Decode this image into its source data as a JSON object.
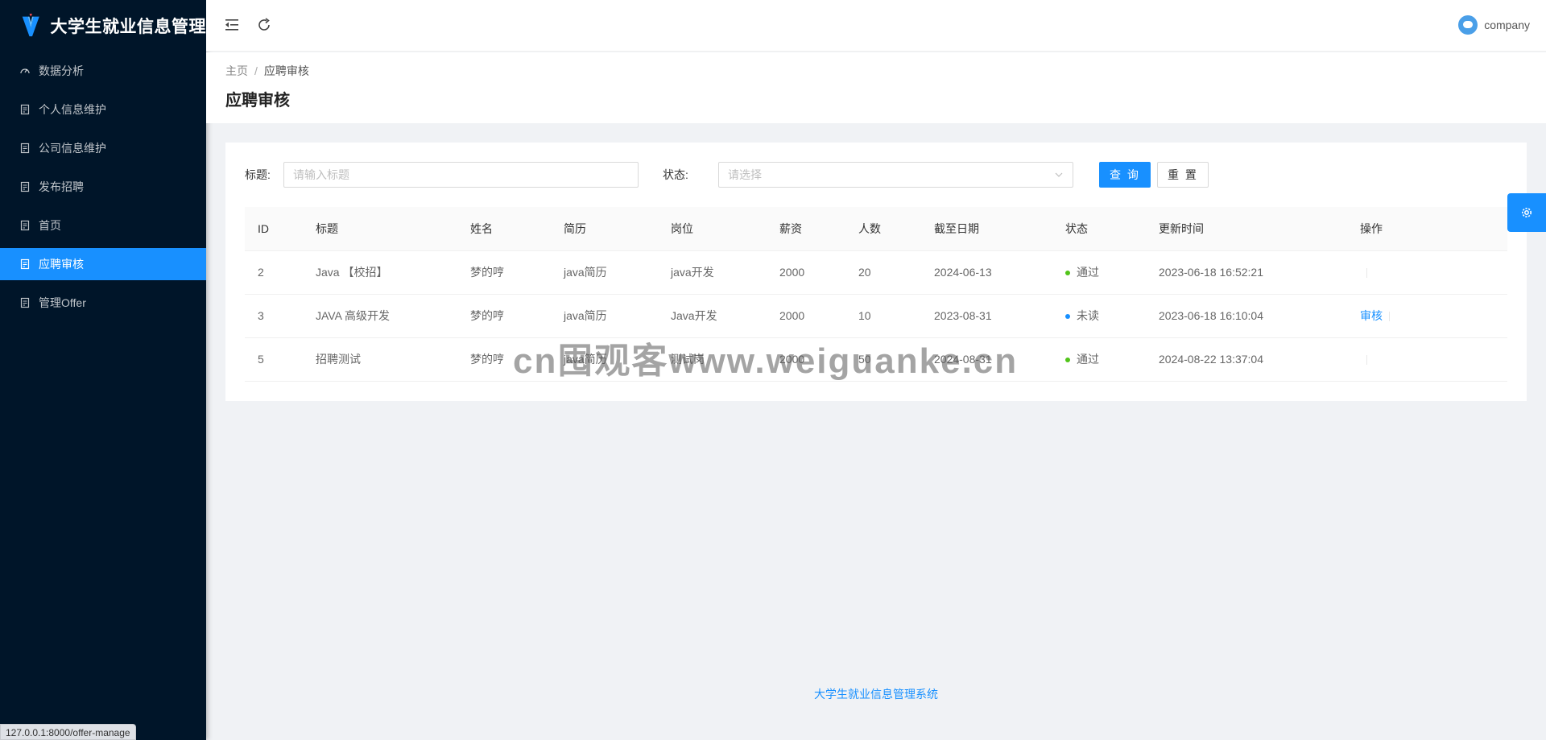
{
  "app": {
    "title": "大学生就业信息管理"
  },
  "sidebar": {
    "items": [
      {
        "label": "数据分析",
        "icon": "dashboard-icon",
        "active": false
      },
      {
        "label": "个人信息维护",
        "icon": "file-icon",
        "active": false
      },
      {
        "label": "公司信息维护",
        "icon": "file-icon",
        "active": false
      },
      {
        "label": "发布招聘",
        "icon": "file-icon",
        "active": false
      },
      {
        "label": "首页",
        "icon": "file-icon",
        "active": false
      },
      {
        "label": "应聘审核",
        "icon": "file-icon",
        "active": true
      },
      {
        "label": "管理Offer",
        "icon": "file-icon",
        "active": false
      }
    ]
  },
  "header": {
    "username": "company",
    "collapse_icon": "menu-fold-icon",
    "reload_icon": "reload-icon"
  },
  "page": {
    "breadcrumb": [
      "主页",
      "应聘审核"
    ],
    "title": "应聘审核"
  },
  "search": {
    "title_label": "标题:",
    "title_placeholder": "请输入标题",
    "status_label": "状态:",
    "status_placeholder": "请选择",
    "query_button": "查 询",
    "reset_button": "重 置"
  },
  "table": {
    "columns": [
      "ID",
      "标题",
      "姓名",
      "简历",
      "岗位",
      "薪资",
      "人数",
      "截至日期",
      "状态",
      "更新时间",
      "操作"
    ],
    "rows": [
      {
        "id": "2",
        "title": "Java 【校招】",
        "name": "梦的哼",
        "resume": "java简历",
        "position": "java开发",
        "salary": "2000",
        "count": "20",
        "deadline": "2024-06-13",
        "status": "通过",
        "status_color": "#52c41a",
        "updated": "2023-06-18 16:52:21",
        "action": ""
      },
      {
        "id": "3",
        "title": "JAVA 高级开发",
        "name": "梦的哼",
        "resume": "java简历",
        "position": "Java开发",
        "salary": "2000",
        "count": "10",
        "deadline": "2023-08-31",
        "status": "未读",
        "status_color": "#1890ff",
        "updated": "2023-06-18 16:10:04",
        "action": "审核"
      },
      {
        "id": "5",
        "title": "招聘测试",
        "name": "梦的哼",
        "resume": "java简历",
        "position": "测试岗",
        "salary": "2000",
        "count": "50",
        "deadline": "2024-08-31",
        "status": "通过",
        "status_color": "#52c41a",
        "updated": "2024-08-22 13:37:04",
        "action": ""
      }
    ]
  },
  "footer": {
    "text": "大学生就业信息管理系统"
  },
  "browser": {
    "status_url": "127.0.0.1:8000/offer-manage"
  },
  "watermark": {
    "text": "cn囤观客www.weiguanke.cn"
  },
  "colors": {
    "sidebar_bg": "#001529",
    "primary": "#1890ff",
    "success": "#52c41a"
  }
}
